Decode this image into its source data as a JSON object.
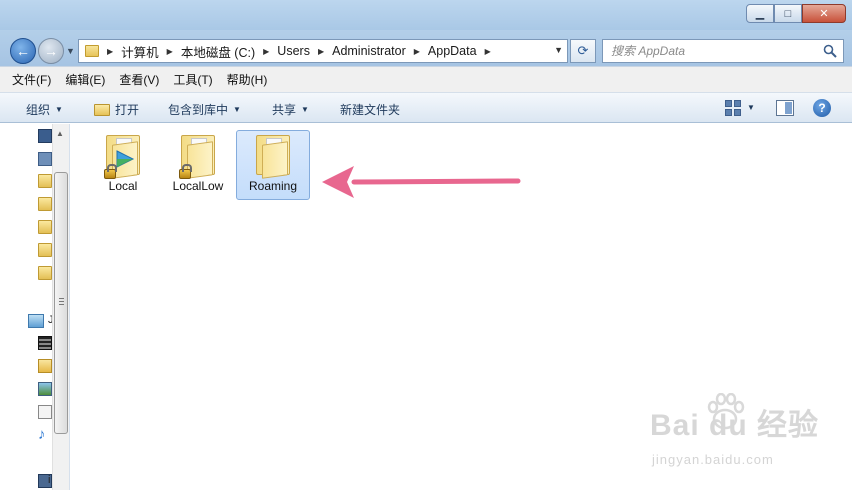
{
  "window": {
    "minimize_label": "▁",
    "maximize_label": "□",
    "close_label": "✕"
  },
  "nav": {
    "back_icon": "arrow-left-icon",
    "forward_icon": "arrow-right-icon"
  },
  "address": {
    "crumbs": [
      "计算机",
      "本地磁盘 (C:)",
      "Users",
      "Administrator",
      "AppData"
    ]
  },
  "search": {
    "placeholder": "搜索 AppData"
  },
  "menu": {
    "items": [
      "文件(F)",
      "编辑(E)",
      "查看(V)",
      "工具(T)",
      "帮助(H)"
    ]
  },
  "toolbar": {
    "organize": "组织",
    "open": "打开",
    "include_in_library": "包含到库中",
    "share": "共享",
    "new_folder": "新建文件夹"
  },
  "navpane": {
    "library_label_fragment": "J",
    "computer_label_fragment": "i"
  },
  "folders": [
    {
      "name": "Local",
      "locked": true,
      "selected": false
    },
    {
      "name": "LocalLow",
      "locked": true,
      "selected": false
    },
    {
      "name": "Roaming",
      "locked": false,
      "selected": true
    }
  ],
  "annotation": {
    "arrow_color": "#e8678f"
  },
  "watermark": {
    "brand": "Bai du 经验",
    "url": "jingyan.baidu.com"
  }
}
